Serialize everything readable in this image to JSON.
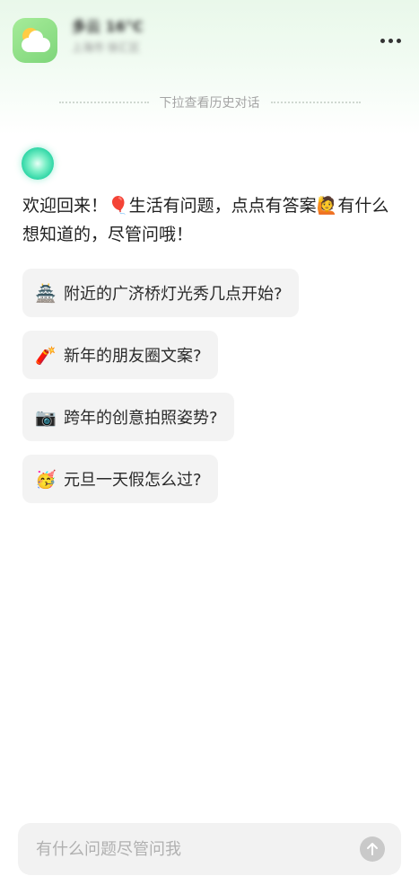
{
  "header": {
    "weather_main": "多云 16°C",
    "weather_sub": "上海市 徐汇区"
  },
  "history_hint": "下拉查看历史对话",
  "welcome": {
    "line": "欢迎回来！🎈生活有问题，点点有答案🙋有什么想知道的，尽管问哦！"
  },
  "suggestions": [
    {
      "emoji": "🏯",
      "emoji_name": "temple-icon",
      "text": "附近的广济桥灯光秀几点开始?"
    },
    {
      "emoji": "🧨",
      "emoji_name": "firecracker-icon",
      "text": "新年的朋友圈文案?"
    },
    {
      "emoji": "📷",
      "emoji_name": "camera-icon",
      "text": "跨年的创意拍照姿势?"
    },
    {
      "emoji": "🥳",
      "emoji_name": "party-face-icon",
      "text": "元旦一天假怎么过?"
    }
  ],
  "input": {
    "placeholder": "有什么问题尽管问我",
    "value": ""
  },
  "colors": {
    "accent": "#2fd6a6",
    "chip_bg": "#f3f3f3",
    "send_button": "#c9c9c9"
  }
}
